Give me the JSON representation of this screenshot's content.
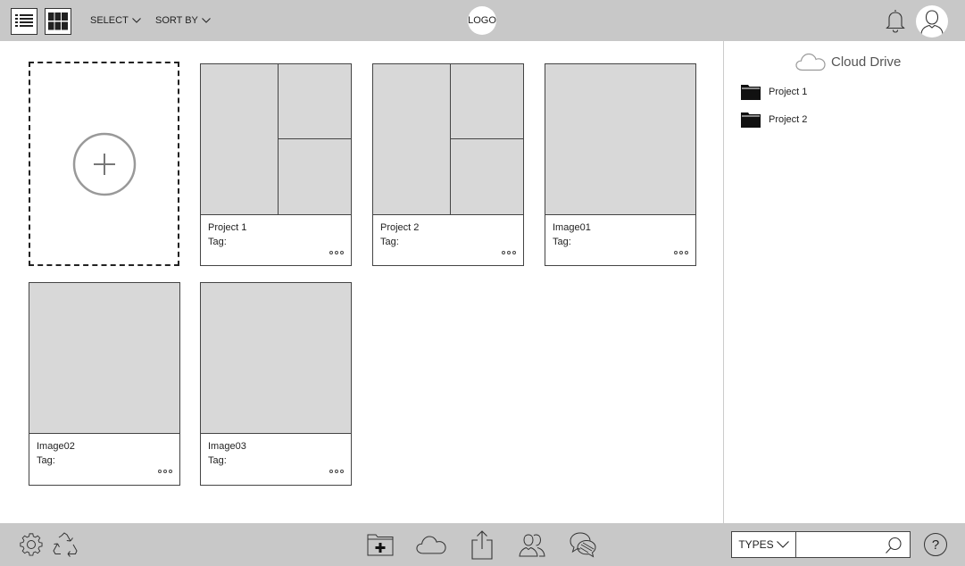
{
  "topbar": {
    "view_list_icon": "list-view-icon",
    "view_grid_icon": "grid-view-icon",
    "select_label": "SELECT",
    "sort_label": "SORT BY",
    "logo": "LOGO",
    "notification_icon": "bell-icon",
    "user_icon": "user-avatar-icon"
  },
  "cards": [
    {
      "title": "Project 1",
      "tag": "Tag:",
      "thumb": "split"
    },
    {
      "title": "Project 2",
      "tag": "Tag:",
      "thumb": "split"
    },
    {
      "title": "Image01",
      "tag": "Tag:",
      "thumb": "single"
    },
    {
      "title": "Image02",
      "tag": "Tag:",
      "thumb": "single"
    },
    {
      "title": "Image03",
      "tag": "Tag:",
      "thumb": "single"
    }
  ],
  "sidebar": {
    "title": "Cloud Drive",
    "folders": [
      {
        "label": "Project 1"
      },
      {
        "label": "Project 2"
      }
    ]
  },
  "bottombar": {
    "icons": [
      "settings-icon",
      "recycle-icon",
      "new-folder-icon",
      "cloud-icon",
      "share-icon",
      "users-icon",
      "chat-icon"
    ],
    "types_label": "TYPES",
    "search_placeholder": "",
    "help_label": "?"
  },
  "colors": {
    "bar_bg": "#c8c8c8",
    "thumb_bg": "#d8d8d8",
    "border": "#444444"
  }
}
